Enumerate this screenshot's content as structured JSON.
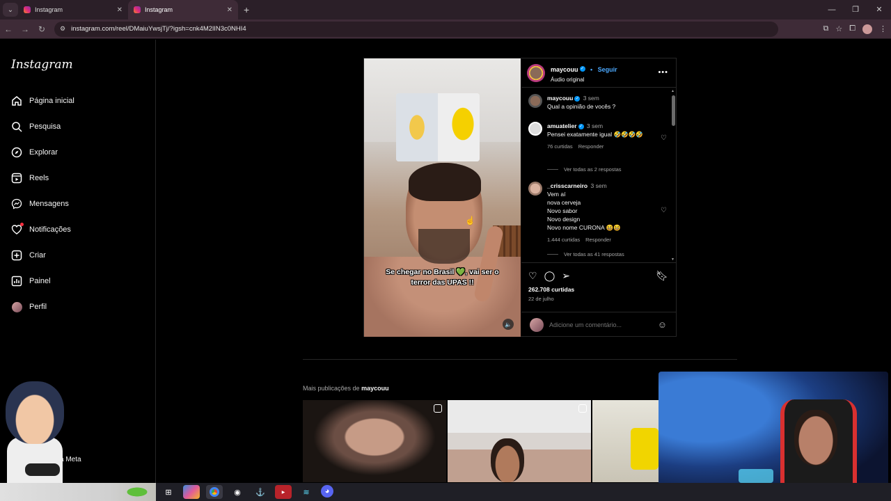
{
  "browser": {
    "tabs": [
      {
        "title": "Instagram",
        "active": false
      },
      {
        "title": "Instagram",
        "active": true
      }
    ],
    "url": "instagram.com/reel/DMaiuYwsjTj/?igsh=cnk4M2lIN3c0NHI4"
  },
  "sidebar": {
    "logo": "Instagram",
    "items": [
      {
        "label": "Página inicial",
        "icon": "home-icon"
      },
      {
        "label": "Pesquisa",
        "icon": "search-icon"
      },
      {
        "label": "Explorar",
        "icon": "compass-icon"
      },
      {
        "label": "Reels",
        "icon": "reels-icon"
      },
      {
        "label": "Mensagens",
        "icon": "messenger-icon"
      },
      {
        "label": "Notificações",
        "icon": "heart-icon"
      },
      {
        "label": "Criar",
        "icon": "plus-square-icon"
      },
      {
        "label": "Painel",
        "icon": "chart-icon"
      },
      {
        "label": "Perfil",
        "icon": "profile-avatar"
      }
    ],
    "meta_text": "a Meta"
  },
  "reel": {
    "video_caption": "Se chegar no Brasil 💚, vai ser o terror das UPAS !!",
    "author": "maycouu",
    "follow_label": "Seguir",
    "audio_label": "Áudio original",
    "comments": [
      {
        "user": "maycouu",
        "time": "3 sem",
        "text": "Qual a opinião de vocês ?"
      },
      {
        "user": "amuatelier",
        "time": "3 sem",
        "text": "Pensei exatamente igual 🤣🤣🤣🤣",
        "likes": "76 curtidas",
        "reply": "Responder",
        "view_replies": "Ver todas as 2 respostas"
      },
      {
        "user": "_crisscarneiro",
        "time": "3 sem",
        "lines": [
          "Vem aí",
          "nova cerveja",
          "Novo sabor",
          "Novo design",
          "Novo nome CURONA 😆😆"
        ],
        "likes": "1.444 curtidas",
        "reply": "Responder",
        "view_replies": "Ver todas as 41 respostas"
      }
    ],
    "likes_count": "262.708 curtidas",
    "date": "22 de julho",
    "comment_placeholder": "Adicione um comentário..."
  },
  "more_posts": {
    "prefix": "Mais publicações de",
    "user": "maycouu"
  },
  "colors": {
    "accent": "#0095f6",
    "follow": "#4ca9ff",
    "notification_dot": "#ff3040"
  }
}
